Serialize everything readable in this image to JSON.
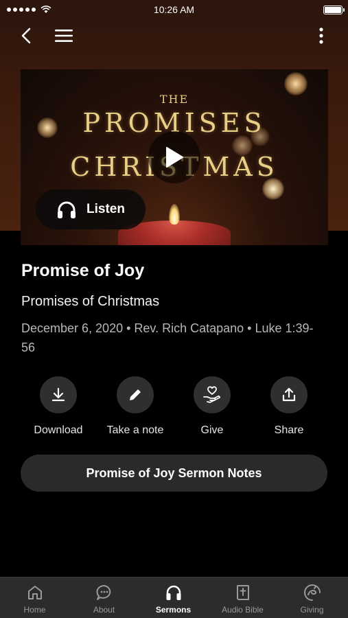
{
  "status_bar": {
    "time": "10:26 AM"
  },
  "nav": {
    "back_icon": "chevron-left-icon",
    "menu_icon": "hamburger-menu-icon",
    "more_icon": "more-vertical-icon"
  },
  "video": {
    "art_line_1": "THE",
    "art_line_2": "PROMISES",
    "art_line_3": "CHRISTMAS",
    "listen_label": "Listen"
  },
  "sermon": {
    "title": "Promise of Joy",
    "series": "Promises of Christmas",
    "meta": "December 6, 2020 • Rev. Rich Catapano • Luke 1:39-56"
  },
  "actions": [
    {
      "label": "Download",
      "icon": "download-icon"
    },
    {
      "label": "Take a note",
      "icon": "pencil-icon"
    },
    {
      "label": "Give",
      "icon": "giving-hand-heart-icon"
    },
    {
      "label": "Share",
      "icon": "share-icon"
    }
  ],
  "notes_button": {
    "label": "Promise of Joy Sermon Notes"
  },
  "tabs": [
    {
      "label": "Home",
      "icon": "home-icon",
      "active": false
    },
    {
      "label": "About",
      "icon": "chat-bubble-icon",
      "active": false
    },
    {
      "label": "Sermons",
      "icon": "headphones-icon",
      "active": true
    },
    {
      "label": "Audio Bible",
      "icon": "bible-icon",
      "active": false
    },
    {
      "label": "Giving",
      "icon": "giving-icon",
      "active": false
    }
  ],
  "colors": {
    "accent_gold": "#e8cf86",
    "background": "#000000",
    "tab_bar": "#2c2c2c",
    "button": "#2a2a2a"
  }
}
